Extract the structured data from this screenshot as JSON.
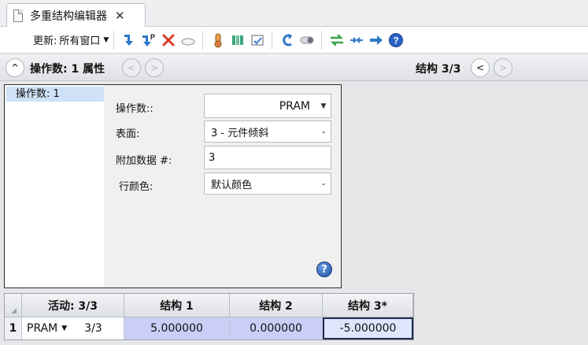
{
  "window": {
    "tab_title": "多重结构编辑器",
    "tab_close": "✕"
  },
  "toolbar": {
    "update_label": "更新:",
    "update_value": "所有窗口",
    "tools": [
      "insert-configuration-icon",
      "insert-config-with-pickups-icon",
      "delete-configuration-icon",
      "select-config-icon",
      "make-thermal-icon",
      "make-solves-icon",
      "make-table-icon",
      "reload-icon",
      "toggle-icon",
      "swap-configs-icon",
      "pickup-chain-icon",
      "next-config-icon",
      "help-icon"
    ]
  },
  "nav": {
    "title": "操作数: 1 属性",
    "config": "结构 3/3",
    "collapse_icon": "^",
    "prev_icon": "<",
    "next_icon": ">"
  },
  "operands": {
    "items": [
      {
        "label": "操作数: 1"
      }
    ]
  },
  "props": {
    "operand_label": "操作数::",
    "operand_value": "PRAM",
    "surface_label": "表面:",
    "surface_value": "3 - 元件倾斜",
    "extra_label": "附加数据 #:",
    "extra_value": "3",
    "row_color_label": "行颜色:",
    "row_color_value": "默认颜色",
    "help": "?"
  },
  "grid": {
    "headers": [
      "活动: 3/3",
      "结构 1",
      "结构 2",
      "结构 3*"
    ],
    "rows": [
      {
        "num": "1",
        "operand": "PRAM",
        "ref": "3/3",
        "c1": "5.000000",
        "c2": "0.000000",
        "c3": "-5.000000"
      }
    ]
  },
  "colors": {
    "selection": "#cfe1f6",
    "grid_highlight": "#c9cff6",
    "help_blue": "#2b63c2"
  }
}
